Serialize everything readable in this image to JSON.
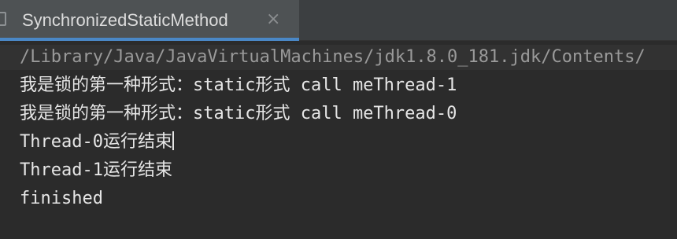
{
  "tab": {
    "title": "SynchronizedStaticMethod",
    "close_glyph": "×",
    "icon": "file-icon"
  },
  "console": {
    "command_line": "/Library/Java/JavaVirtualMachines/jdk1.8.0_181.jdk/Contents/",
    "lines": [
      "我是锁的第一种形式：static形式 call meThread-1",
      "我是锁的第一种形式：static形式 call meThread-0",
      "Thread-0运行结束",
      "Thread-1运行结束",
      "finished"
    ]
  },
  "colors": {
    "background": "#2b2b2b",
    "tab_underline": "#4a88c7",
    "text": "#e6e6e6",
    "command_text": "#9a9a9a"
  }
}
